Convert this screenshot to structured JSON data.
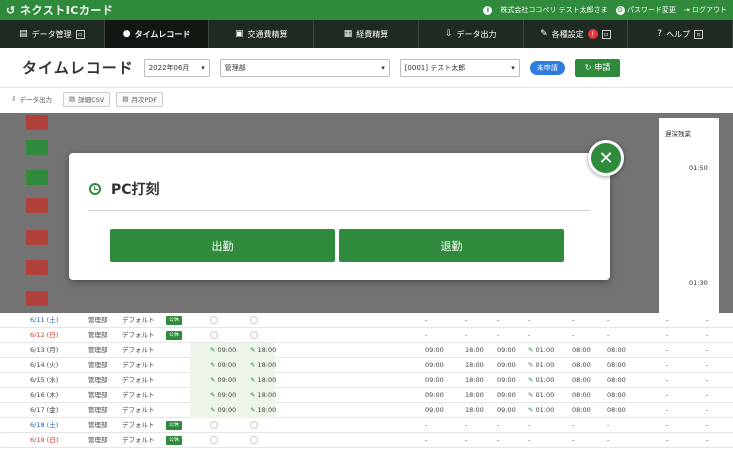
{
  "app": {
    "brand": "ネクストICカード",
    "company": "株式会社ココペリ テスト太郎さま",
    "password_link": "パスワード変更",
    "logout_link": "ログアウト"
  },
  "nav": [
    {
      "label": "データ管理",
      "icon": "data-icon",
      "glyph": "▤"
    },
    {
      "label": "タイムレコード",
      "icon": "clock-icon",
      "glyph": "●"
    },
    {
      "label": "交通費精算",
      "icon": "train-icon",
      "glyph": "▣"
    },
    {
      "label": "経費精算",
      "icon": "receipt-icon",
      "glyph": "▦"
    },
    {
      "label": "データ出力",
      "icon": "download-icon",
      "glyph": "⇩"
    },
    {
      "label": "各種設定",
      "icon": "wrench-icon",
      "glyph": "✎",
      "badge": "!"
    },
    {
      "label": "ヘルプ",
      "icon": "help-icon",
      "glyph": "?"
    }
  ],
  "page": {
    "title": "タイムレコード",
    "month": "2022年06月",
    "department": "管理部",
    "employee": "[0001] テスト太郎",
    "status_pill": "未申請",
    "apply_button": "申請"
  },
  "toolbar": {
    "export": "データ出力",
    "detail_csv": "詳細CSV",
    "monthly_pdf": "月次PDF"
  },
  "column_header_right": "遅深残業",
  "overlay_values": [
    "01:50",
    "01:30"
  ],
  "modal": {
    "title": "PC打刻",
    "clock_in": "出勤",
    "clock_out": "退勤"
  },
  "rows": [
    {
      "date": "6/11 (土)",
      "day_type": "sat",
      "dept": "管理部",
      "pattern": "デフォルト",
      "shuku": "公休",
      "in": "",
      "out": "",
      "c1": "-",
      "c2": "-",
      "c3": "-",
      "c4": "-",
      "c5": "-",
      "c6": "-",
      "c7": "-",
      "c8": "-"
    },
    {
      "date": "6/12 (日)",
      "day_type": "sun",
      "dept": "管理部",
      "pattern": "デフォルト",
      "shuku": "公休",
      "in": "",
      "out": "",
      "c1": "-",
      "c2": "-",
      "c3": "-",
      "c4": "-",
      "c5": "-",
      "c6": "-",
      "c7": "-",
      "c8": "-"
    },
    {
      "date": "6/13 (月)",
      "day_type": "weekday",
      "dept": "管理部",
      "pattern": "デフォルト",
      "shuku": "",
      "in": "09:00",
      "out": "18:00",
      "c1": "09:00",
      "c2": "18:00",
      "c3": "09:00",
      "c4": "01:00",
      "c5": "08:00",
      "c6": "08:00",
      "c7": "-",
      "c8": "-"
    },
    {
      "date": "6/14 (火)",
      "day_type": "weekday",
      "dept": "管理部",
      "pattern": "デフォルト",
      "shuku": "",
      "in": "09:00",
      "out": "18:00",
      "c1": "09:00",
      "c2": "18:00",
      "c3": "09:00",
      "c4": "01:00",
      "c5": "08:00",
      "c6": "08:00",
      "c7": "-",
      "c8": "-"
    },
    {
      "date": "6/15 (水)",
      "day_type": "weekday",
      "dept": "管理部",
      "pattern": "デフォルト",
      "shuku": "",
      "in": "09:00",
      "out": "18:00",
      "c1": "09:00",
      "c2": "18:00",
      "c3": "09:00",
      "c4": "01:00",
      "c5": "08:00",
      "c6": "08:00",
      "c7": "-",
      "c8": "-"
    },
    {
      "date": "6/16 (木)",
      "day_type": "weekday",
      "dept": "管理部",
      "pattern": "デフォルト",
      "shuku": "",
      "in": "09:00",
      "out": "18:00",
      "c1": "09:00",
      "c2": "18:00",
      "c3": "09:00",
      "c4": "01:00",
      "c5": "08:00",
      "c6": "08:00",
      "c7": "-",
      "c8": "-"
    },
    {
      "date": "6/17 (金)",
      "day_type": "weekday",
      "dept": "管理部",
      "pattern": "デフォルト",
      "shuku": "",
      "in": "09:00",
      "out": "18:00",
      "c1": "09:00",
      "c2": "18:00",
      "c3": "09:00",
      "c4": "01:00",
      "c5": "08:00",
      "c6": "08:00",
      "c7": "-",
      "c8": "-"
    },
    {
      "date": "6/18 (土)",
      "day_type": "sat",
      "dept": "管理部",
      "pattern": "デフォルト",
      "shuku": "公休",
      "in": "",
      "out": "",
      "c1": "-",
      "c2": "-",
      "c3": "-",
      "c4": "-",
      "c5": "-",
      "c6": "-",
      "c7": "-",
      "c8": "-"
    },
    {
      "date": "6/19 (日)",
      "day_type": "sun",
      "dept": "管理部",
      "pattern": "デフォルト",
      "shuku": "公休",
      "in": "",
      "out": "",
      "c1": "-",
      "c2": "-",
      "c3": "-",
      "c4": "-",
      "c5": "-",
      "c6": "-",
      "c7": "-",
      "c8": "-"
    }
  ]
}
